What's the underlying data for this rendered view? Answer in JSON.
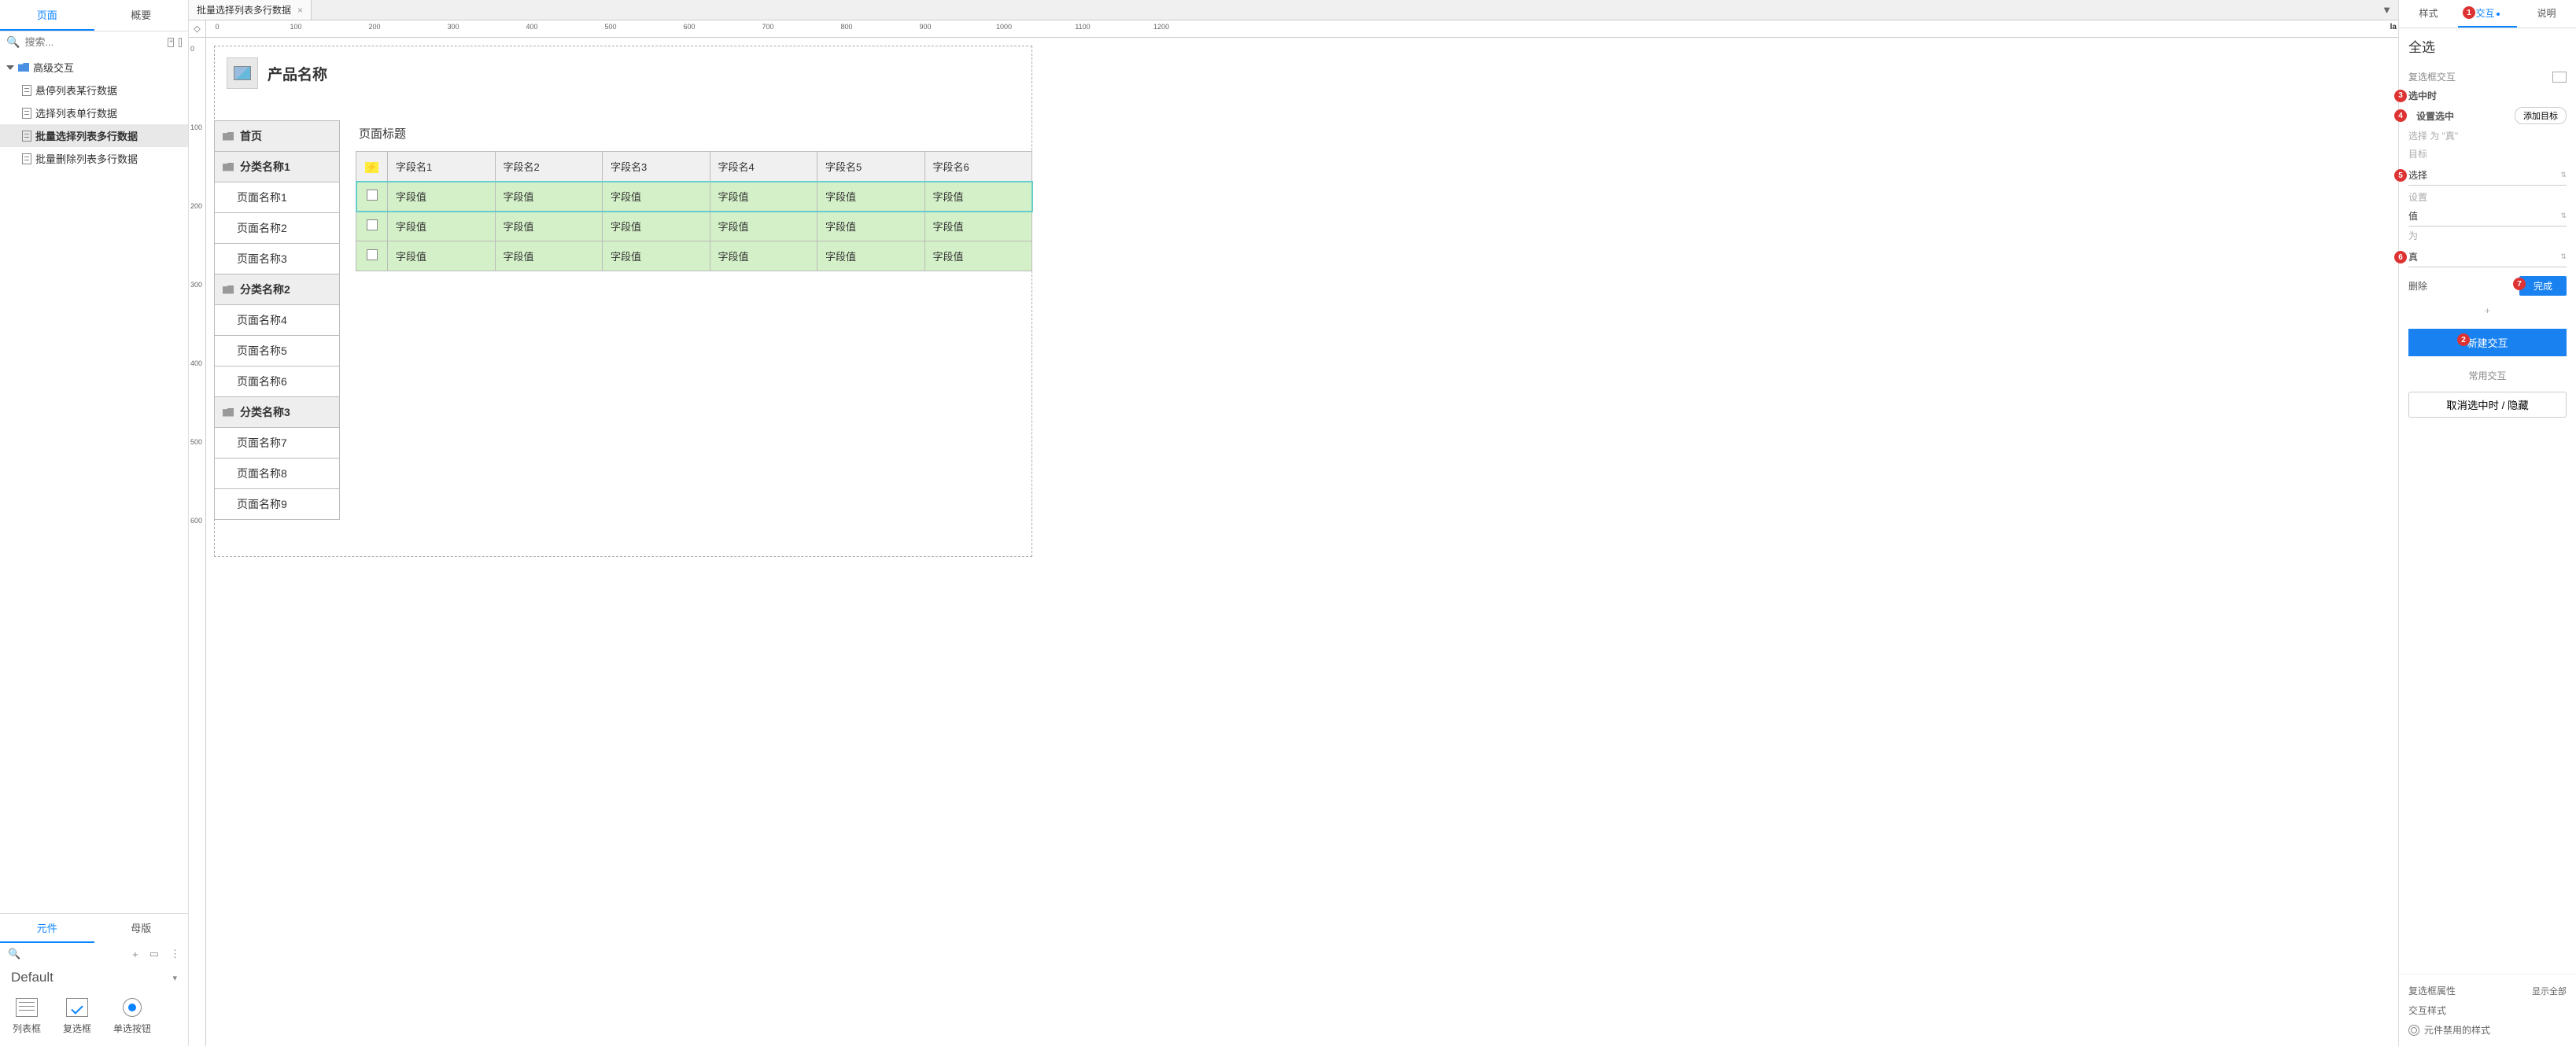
{
  "leftPanel": {
    "tabs": {
      "pages": "页面",
      "overview": "概要"
    },
    "searchPlaceholder": "搜索...",
    "tree": {
      "rootLabel": "高级交互",
      "items": [
        {
          "label": "悬停列表某行数据",
          "sel": false
        },
        {
          "label": "选择列表单行数据",
          "sel": false
        },
        {
          "label": "批量选择列表多行数据",
          "sel": true
        },
        {
          "label": "批量删除列表多行数据",
          "sel": false
        }
      ]
    },
    "sec2Tabs": {
      "widgets": "元件",
      "masters": "母版"
    },
    "defaultLabel": "Default",
    "widgets": [
      {
        "label": "列表框",
        "kind": "list"
      },
      {
        "label": "复选框",
        "kind": "check"
      },
      {
        "label": "单选按钮",
        "kind": "radio"
      }
    ]
  },
  "docTab": "批量选择列表多行数据",
  "rulerH": [
    0,
    100,
    200,
    300,
    400,
    500,
    600,
    700,
    800,
    900,
    1000,
    1100,
    1200
  ],
  "rulerHLabel": "la",
  "rulerV": [
    0,
    100,
    200,
    300,
    400,
    500,
    600
  ],
  "canvas": {
    "productTitle": "产品名称",
    "menu": [
      {
        "label": "首页",
        "cat": true
      },
      {
        "label": "分类名称1",
        "cat": true
      },
      {
        "label": "页面名称1",
        "cat": false
      },
      {
        "label": "页面名称2",
        "cat": false
      },
      {
        "label": "页面名称3",
        "cat": false
      },
      {
        "label": "分类名称2",
        "cat": true
      },
      {
        "label": "页面名称4",
        "cat": false
      },
      {
        "label": "页面名称5",
        "cat": false
      },
      {
        "label": "页面名称6",
        "cat": false
      },
      {
        "label": "分类名称3",
        "cat": true
      },
      {
        "label": "页面名称7",
        "cat": false
      },
      {
        "label": "页面名称8",
        "cat": false
      },
      {
        "label": "页面名称9",
        "cat": false
      }
    ],
    "pageTitle": "页面标题",
    "tableHeaders": [
      "字段名1",
      "字段名2",
      "字段名3",
      "字段名4",
      "字段名5",
      "字段名6"
    ],
    "cellValue": "字段值",
    "rowCount": 3
  },
  "rightPanel": {
    "tabs": {
      "style": "样式",
      "interact": "交互",
      "notes": "说明"
    },
    "title": "全选",
    "secHeader": "复选框交互",
    "event": "选中时",
    "action": "设置选中",
    "addTarget": "添加目标",
    "hint": "选择 为 \"真\"",
    "targetLabel": "目标",
    "targetValue": "选择",
    "setLabel": "设置",
    "setValue": "值",
    "toLabel": "为",
    "toValue": "真",
    "delete": "删除",
    "done": "完成",
    "newInteraction": "新建交互",
    "commonHead": "常用交互",
    "commonBtn": "取消选中时 / 隐藏",
    "propsHead": "复选框属性",
    "showAll": "显示全部",
    "ixStyle": "交互样式",
    "disabledStyle": "元件禁用的样式"
  },
  "badges": {
    "b1": "1",
    "b2": "2",
    "b3": "3",
    "b4": "4",
    "b5": "5",
    "b6": "6",
    "b7": "7"
  }
}
